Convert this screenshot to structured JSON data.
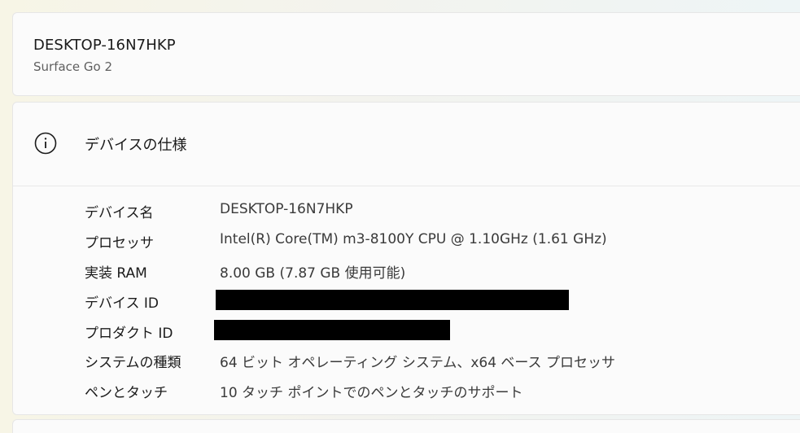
{
  "device": {
    "name": "DESKTOP-16N7HKP",
    "model": "Surface Go 2"
  },
  "specs": {
    "title": "デバイスの仕様",
    "icon": "info-icon",
    "rows": [
      {
        "label": "デバイス名",
        "value": "DESKTOP-16N7HKP"
      },
      {
        "label": "プロセッサ",
        "value": "Intel(R) Core(TM) m3-8100Y CPU @ 1.10GHz (1.61 GHz)"
      },
      {
        "label": "実装 RAM",
        "value": "8.00 GB (7.87 GB 使用可能)"
      },
      {
        "label": "デバイス ID",
        "value": "",
        "redacted": true
      },
      {
        "label": "プロダクト ID",
        "value": "",
        "redacted": true
      },
      {
        "label": "システムの種類",
        "value": "64 ビット オペレーティング システム、x64 ベース プロセッサ"
      },
      {
        "label": "ペンとタッチ",
        "value": "10 タッチ ポイントでのペンとタッチのサポート"
      }
    ]
  }
}
